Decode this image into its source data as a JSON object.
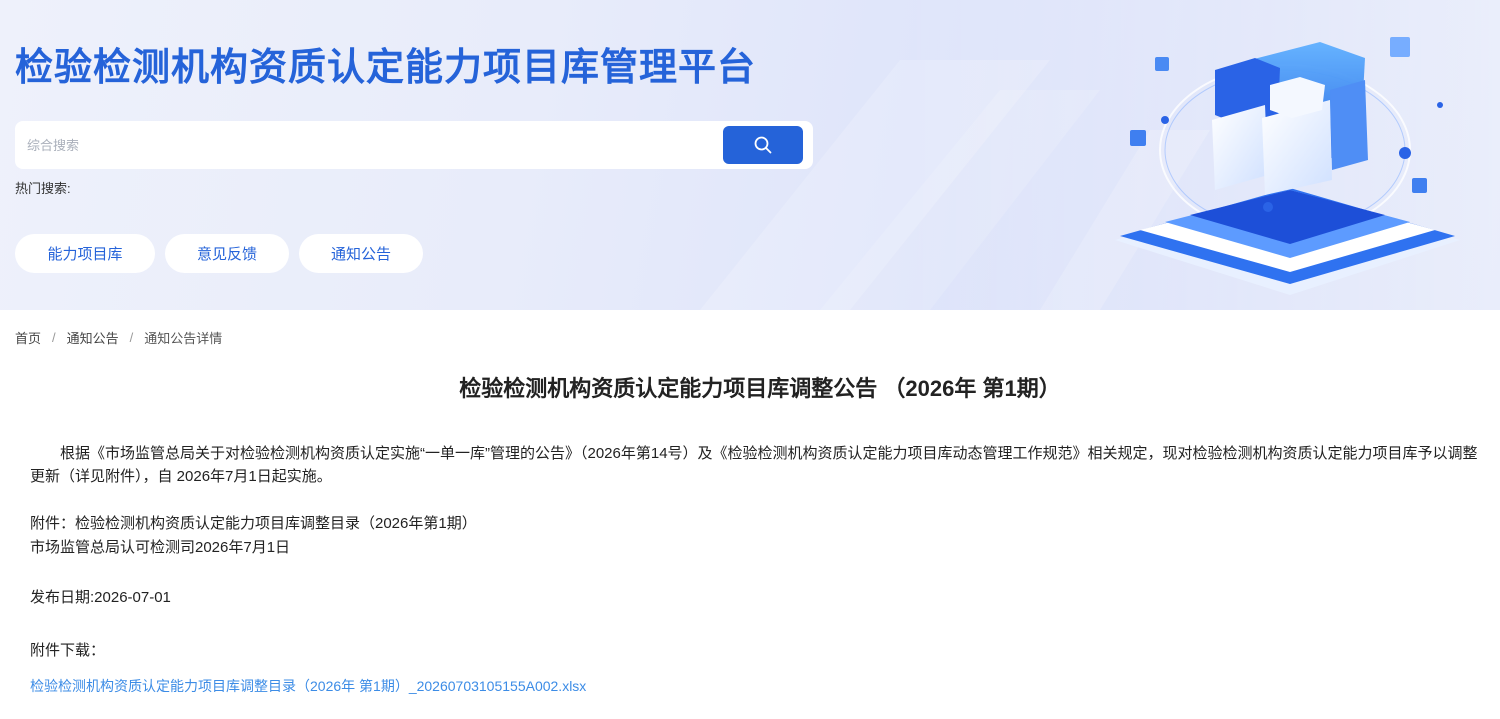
{
  "header": {
    "site_title": "检验检测机构资质认定能力项目库管理平台",
    "search_placeholder": "综合搜索",
    "hot_search_label": "热门搜索:",
    "nav": [
      {
        "label": "能力项目库"
      },
      {
        "label": "意见反馈"
      },
      {
        "label": "通知公告"
      }
    ],
    "icons": {
      "search_button": "search-icon",
      "banner_art": "data-cube-illustration"
    },
    "colors": {
      "accent": "#2563d9",
      "link": "#3c8ce6"
    }
  },
  "breadcrumb": {
    "items": [
      "首页",
      "通知公告",
      "通知公告详情"
    ],
    "separator": "/"
  },
  "article": {
    "title": "检验检测机构资质认定能力项目库调整公告 （2026年 第1期）",
    "body": "根据《市场监管总局关于对检验检测机构资质认定实施“一单一库”管理的公告》（2026年第14号）及《检验检测机构资质认定能力项目库动态管理工作规范》相关规定，现对检验检测机构资质认定能力项目库予以调整更新（详见附件），自 2026年7月1日起实施。",
    "attachment_line": "附件：检验检测机构资质认定能力项目库调整目录（2026年第1期）",
    "signature": "市场监管总局认可检测司2026年7月1日",
    "publish_date": "发布日期:2026-07-01",
    "download_label": "附件下载：",
    "download_file": "检验检测机构资质认定能力项目库调整目录（2026年 第1期）_20260703105155A002.xlsx"
  }
}
